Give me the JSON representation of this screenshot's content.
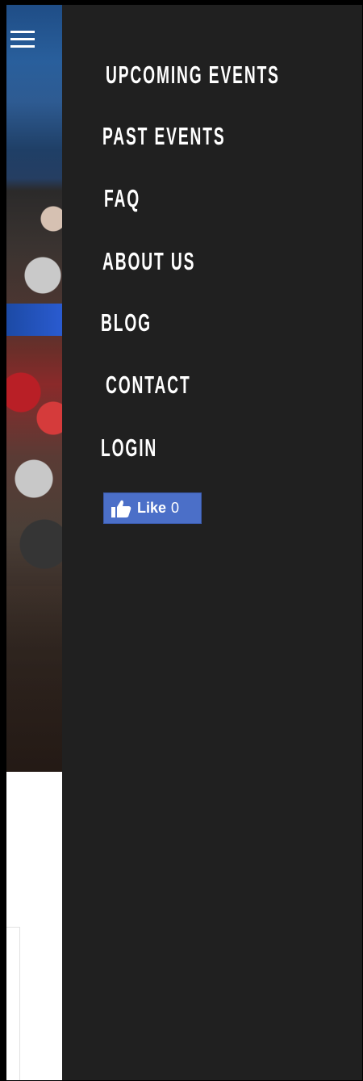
{
  "menu": {
    "items": [
      {
        "label": "UPCOMING EVENTS"
      },
      {
        "label": "PAST EVENTS"
      },
      {
        "label": "FAQ"
      },
      {
        "label": "ABOUT US"
      },
      {
        "label": "BLOG"
      },
      {
        "label": "CONTACT"
      },
      {
        "label": "LOGIN"
      }
    ],
    "facebook_like": {
      "label": "Like",
      "count": "0",
      "icon": "thumbs-up-icon"
    }
  },
  "header": {
    "menu_icon": "hamburger-icon"
  },
  "colors": {
    "menu_background": "#202020",
    "menu_text": "#ffffff",
    "facebook_blue": "#4b6fc8"
  }
}
